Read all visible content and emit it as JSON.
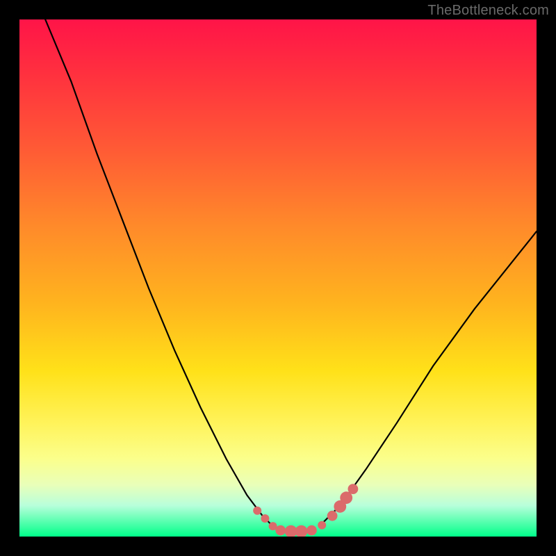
{
  "watermark": "TheBottleneck.com",
  "colors": {
    "background_page": "#000000",
    "gradient_top": "#ff1448",
    "gradient_mid": "#ffe119",
    "gradient_bottom": "#00ff8a",
    "curve": "#000000",
    "marker": "#db6b6b"
  },
  "chart_data": {
    "type": "line",
    "title": "",
    "xlabel": "",
    "ylabel": "",
    "xlim": [
      0,
      1
    ],
    "ylim": [
      0,
      1
    ],
    "series": [
      {
        "name": "left-branch",
        "x": [
          0.05,
          0.1,
          0.15,
          0.2,
          0.25,
          0.3,
          0.35,
          0.4,
          0.44,
          0.47,
          0.49
        ],
        "y": [
          1.0,
          0.88,
          0.74,
          0.61,
          0.48,
          0.36,
          0.25,
          0.15,
          0.08,
          0.04,
          0.02
        ]
      },
      {
        "name": "right-branch",
        "x": [
          0.58,
          0.62,
          0.67,
          0.73,
          0.8,
          0.88,
          0.96,
          1.0
        ],
        "y": [
          0.02,
          0.06,
          0.13,
          0.22,
          0.33,
          0.44,
          0.54,
          0.59
        ]
      }
    ],
    "markers": {
      "name": "bottom-cluster",
      "points": [
        {
          "x": 0.46,
          "y": 0.05,
          "r": 0.008
        },
        {
          "x": 0.475,
          "y": 0.035,
          "r": 0.008
        },
        {
          "x": 0.49,
          "y": 0.02,
          "r": 0.008
        },
        {
          "x": 0.505,
          "y": 0.012,
          "r": 0.01
        },
        {
          "x": 0.525,
          "y": 0.01,
          "r": 0.012
        },
        {
          "x": 0.545,
          "y": 0.01,
          "r": 0.012
        },
        {
          "x": 0.565,
          "y": 0.012,
          "r": 0.01
        },
        {
          "x": 0.585,
          "y": 0.022,
          "r": 0.008
        },
        {
          "x": 0.605,
          "y": 0.04,
          "r": 0.01
        },
        {
          "x": 0.62,
          "y": 0.058,
          "r": 0.012
        },
        {
          "x": 0.632,
          "y": 0.075,
          "r": 0.012
        },
        {
          "x": 0.645,
          "y": 0.092,
          "r": 0.01
        }
      ]
    }
  }
}
